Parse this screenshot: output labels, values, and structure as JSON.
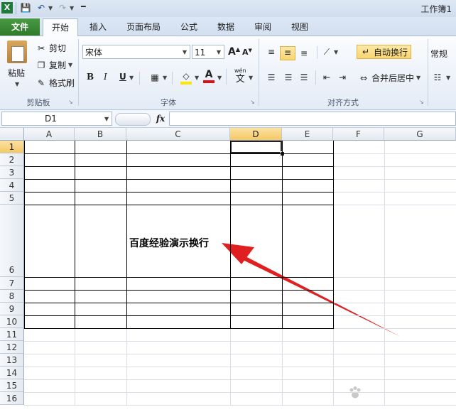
{
  "window": {
    "title": "工作簿1"
  },
  "tabs": [
    "文件",
    "开始",
    "插入",
    "页面布局",
    "公式",
    "数据",
    "审阅",
    "视图"
  ],
  "clipboard": {
    "paste": "粘贴",
    "cut": "剪切",
    "copy": "复制",
    "format_painter": "格式刷",
    "group": "剪贴板"
  },
  "font": {
    "name": "宋体",
    "size": "11",
    "bold": "B",
    "italic": "I",
    "underline": "U",
    "group": "字体",
    "wen": "wén",
    "wen_char": "文"
  },
  "alignment": {
    "wrap": "自动换行",
    "merge": "合并后居中",
    "group": "对齐方式"
  },
  "number": {
    "format": "常规"
  },
  "formula_bar": {
    "name_box": "D1",
    "fx": "fx",
    "formula": ""
  },
  "sheet": {
    "columns": [
      "A",
      "B",
      "C",
      "D",
      "E",
      "F",
      "G"
    ],
    "rows": [
      "1",
      "2",
      "3",
      "4",
      "5",
      "6",
      "7",
      "8",
      "9",
      "10",
      "11",
      "12",
      "13",
      "14",
      "15",
      "16"
    ],
    "selected_column": "D",
    "selected_row": "1",
    "cell_C6": "百度经验演示换行"
  },
  "watermark": "Baidu经验",
  "colors": {
    "file_tab": "#2f7a2b",
    "selection": "#f5c864",
    "arrow": "#e02020"
  }
}
